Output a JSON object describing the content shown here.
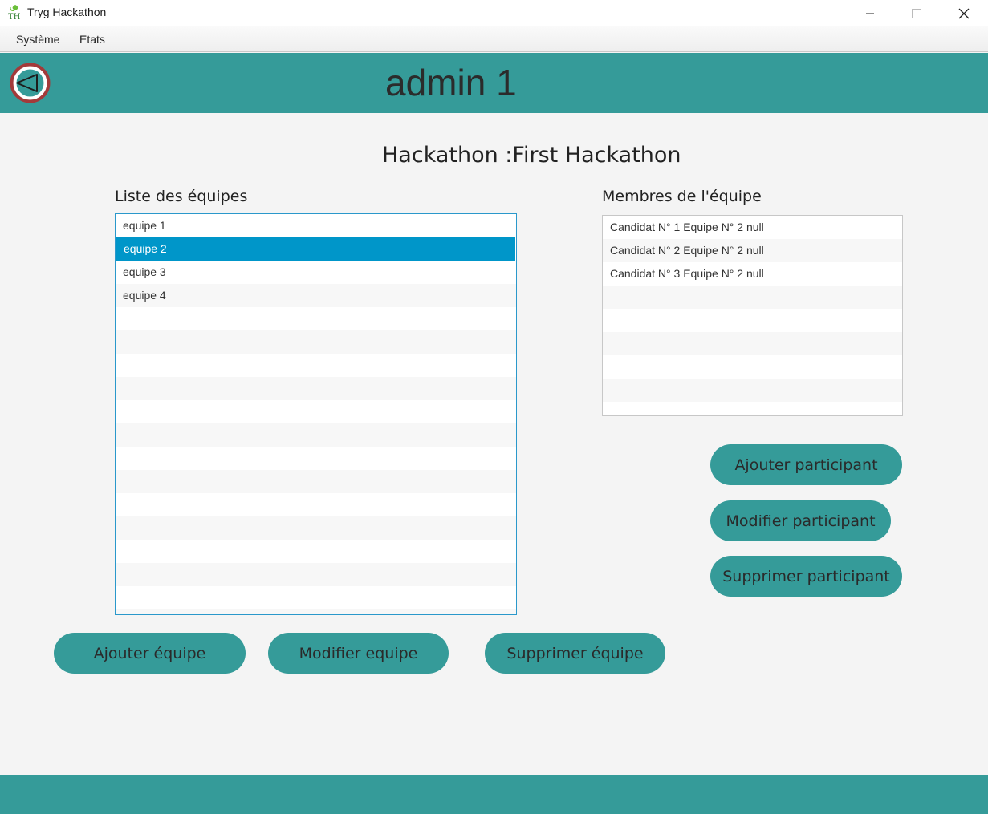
{
  "window": {
    "title": "Tryg Hackathon",
    "icon": "app-logo-icon",
    "controls": {
      "minimize": "—",
      "maximize": "□",
      "close": "✕"
    }
  },
  "menubar": {
    "items": [
      "Système",
      "Etats"
    ]
  },
  "header": {
    "title": "admin 1",
    "back_icon": "back-arrow-icon"
  },
  "main": {
    "hackathon_title": "Hackathon :First Hackathon",
    "teams_label": "Liste des équipes",
    "members_label": "Membres de l'équipe",
    "teams": [
      "equipe 1",
      "equipe 2",
      "equipe 3",
      "equipe 4"
    ],
    "selected_team": "equipe 2",
    "members": [
      "Candidat N° 1 Equipe N° 2 null",
      "Candidat N° 2 Equipe N° 2 null",
      "Candidat N° 3 Equipe N° 2 null"
    ],
    "participant_buttons": {
      "add": "Ajouter participant",
      "edit": "Modifier participant",
      "delete": "Supprimer participant"
    },
    "team_buttons": {
      "add": "Ajouter équipe",
      "edit": "Modifier equipe",
      "delete": "Supprimer équipe"
    }
  },
  "colors": {
    "accent": "#359b99",
    "selection": "#0096c9",
    "back_button_ring": "#a33a3a"
  }
}
